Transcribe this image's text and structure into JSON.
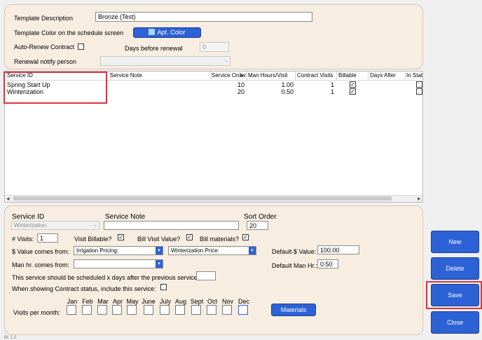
{
  "template": {
    "description_label": "Template Description",
    "description_value": "Bronze (Test)",
    "color_label": "Template Color on the schedule screen",
    "color_button": "Apt. Color",
    "color_swatch": "#a6d8f5",
    "auto_renew_label": "Auto-Renew Contract",
    "days_before_label": "Days before renewal",
    "days_before_value": "0",
    "notify_label": "Renewal notify person"
  },
  "grid": {
    "columns": [
      "Service ID",
      "Service Note",
      "Service Order",
      "Man Hours/Visit",
      "Contract Visits",
      "Billable",
      "Days After",
      "In State"
    ],
    "rows": [
      {
        "service_id": "Spring Start Up",
        "note": "",
        "order": "10",
        "hours": "1.00",
        "visits": "1",
        "billable": true,
        "instate": false
      },
      {
        "service_id": "Winterization",
        "note": "",
        "order": "20",
        "hours": "0.50",
        "visits": "1",
        "billable": true,
        "instate": false
      }
    ],
    "sort_glyph": "▲",
    "scroll_left": "◂",
    "scroll_right": "▸"
  },
  "detail": {
    "service_id_label": "Service ID",
    "service_id_value": "Winterization",
    "service_note_label": "Service Note",
    "sort_order_label": "Sort Order",
    "sort_order_value": "20",
    "visits_label": "# Visits:",
    "visits_value": "1",
    "visit_billable_label": "Visit Billable?",
    "bill_visit_label": "Bill Visit Value?",
    "bill_materials_label": "Bill materials?",
    "value_from_label": "$ Value comes from:",
    "value_from_value": "Irrigation Pricing:",
    "value_from2_value": "Winterization Price:",
    "default_value_label": "Default $ Value:",
    "default_value_value": "100.00",
    "manhr_from_label": "Man hr. comes from:",
    "default_manhr_label": "Default Man Hr.:",
    "default_manhr_value": "0.50",
    "schedule_label": "This service should be scheduled x days after the previous service:",
    "contract_status_label": "When showing Contract status, include this service:",
    "visits_per_month_label": "Visits per month:",
    "months": [
      "Jan",
      "Feb",
      "Mar",
      "Apr",
      "May",
      "June",
      "July",
      "Aug",
      "Sept",
      "Oct",
      "Nov",
      "Dec"
    ],
    "materials_button": "Materials"
  },
  "side_buttons": {
    "new": "New",
    "delete": "Delete",
    "save": "Save",
    "close": "Close"
  },
  "status_text": "Bt: 1.0",
  "colors": {
    "accent": "#2d62d6",
    "highlight": "#d9363e",
    "panel": "#f7ede1"
  }
}
